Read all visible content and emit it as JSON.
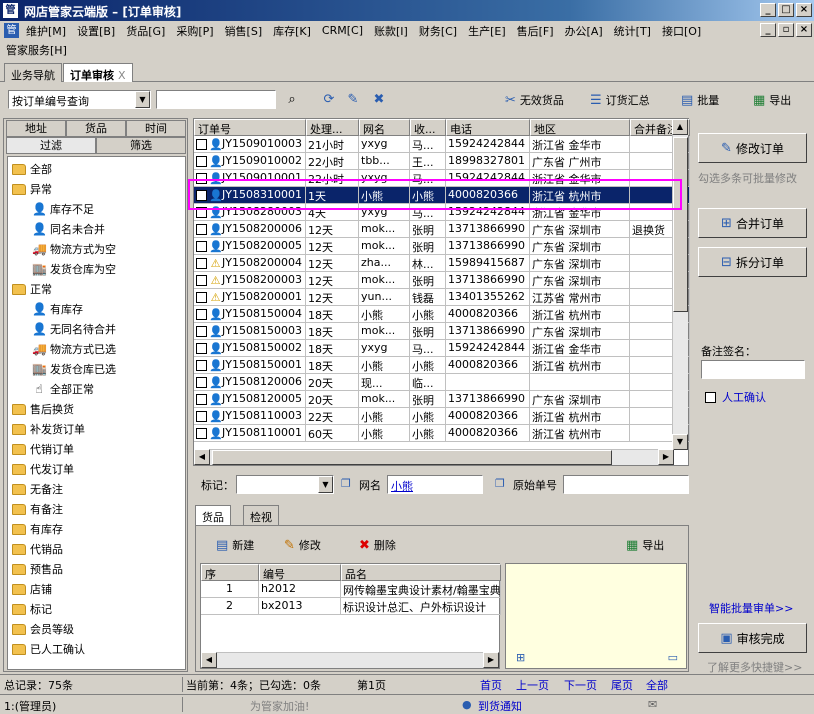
{
  "window": {
    "title": "网店管家云端版 – [订单审核]",
    "logo": "管"
  },
  "menu": [
    "维护[M]",
    "设置[B]",
    "货品[G]",
    "采购[P]",
    "销售[S]",
    "库存[K]",
    "CRM[C]",
    "账款[I]",
    "财务[C]",
    "生产[E]",
    "售后[F]",
    "办公[A]",
    "统计[T]",
    "接口[O]"
  ],
  "menu2": "管家服务[H]",
  "tabs": [
    {
      "label": "业务导航"
    },
    {
      "label": "订单审核"
    }
  ],
  "toolbar": {
    "query_mode": "按订单编号查询",
    "search_value": "",
    "invalid": "无效货品",
    "summary": "订货汇总",
    "batch": "批量",
    "export": "导出"
  },
  "left": {
    "tabs": [
      "地址",
      "货品",
      "时间",
      "过滤",
      "筛选"
    ],
    "tree": [
      {
        "label": "全部",
        "lvl": 0,
        "icon": "folder"
      },
      {
        "label": "异常",
        "lvl": 0,
        "icon": "folder"
      },
      {
        "label": "库存不足",
        "lvl": 1,
        "icon": "person"
      },
      {
        "label": "同名未合并",
        "lvl": 1,
        "icon": "person"
      },
      {
        "label": "物流方式为空",
        "lvl": 1,
        "icon": "truck"
      },
      {
        "label": "发货仓库为空",
        "lvl": 1,
        "icon": "warehouse"
      },
      {
        "label": "正常",
        "lvl": 0,
        "icon": "folder"
      },
      {
        "label": "有库存",
        "lvl": 1,
        "icon": "person"
      },
      {
        "label": "无同名待合并",
        "lvl": 1,
        "icon": "person"
      },
      {
        "label": "物流方式已选",
        "lvl": 1,
        "icon": "truck"
      },
      {
        "label": "发货仓库已选",
        "lvl": 1,
        "icon": "warehouse"
      },
      {
        "label": "全部正常",
        "lvl": 1,
        "icon": "hand"
      },
      {
        "label": "售后换货",
        "lvl": 0,
        "icon": "folder"
      },
      {
        "label": "补发货订单",
        "lvl": 0,
        "icon": "folder"
      },
      {
        "label": "代销订单",
        "lvl": 0,
        "icon": "folder"
      },
      {
        "label": "代发订单",
        "lvl": 0,
        "icon": "folder"
      },
      {
        "label": "无备注",
        "lvl": 0,
        "icon": "folder"
      },
      {
        "label": "有备注",
        "lvl": 0,
        "icon": "folder"
      },
      {
        "label": "有库存",
        "lvl": 0,
        "icon": "folder"
      },
      {
        "label": "代销品",
        "lvl": 0,
        "icon": "folder"
      },
      {
        "label": "预售品",
        "lvl": 0,
        "icon": "folder"
      },
      {
        "label": "店铺",
        "lvl": 0,
        "icon": "folder"
      },
      {
        "label": "标记",
        "lvl": 0,
        "icon": "folder"
      },
      {
        "label": "会员等级",
        "lvl": 0,
        "icon": "folder"
      },
      {
        "label": "已人工确认",
        "lvl": 0,
        "icon": "folder"
      }
    ]
  },
  "grid": {
    "headers": [
      "订单号",
      "处理...",
      "网名",
      "收...",
      "电话",
      "地区",
      "合并备注"
    ],
    "rows": [
      [
        "JY1509010003",
        "21小时",
        "yxyg",
        "马...",
        "15924242844",
        "浙江省 金华市",
        ""
      ],
      [
        "JY1509010002",
        "22小时",
        "tbb...",
        "王...",
        "18998327801",
        "广东省 广州市",
        ""
      ],
      [
        "JY1509010001",
        "22小时",
        "yxyg",
        "马...",
        "15924242844",
        "浙江省 金华市",
        ""
      ],
      [
        "JY1508310001",
        "1天",
        "小熊",
        "小熊",
        "4000820366",
        "浙江省 杭州市",
        ""
      ],
      [
        "JY1508280003",
        "4天",
        "yxyg",
        "马...",
        "15924242844",
        "浙江省 金华市",
        ""
      ],
      [
        "JY1508200006",
        "12天",
        "mok...",
        "张明",
        "13713866990",
        "广东省 深圳市",
        "退换货"
      ],
      [
        "JY1508200005",
        "12天",
        "mok...",
        "张明",
        "13713866990",
        "广东省 深圳市",
        ""
      ],
      [
        "JY1508200004",
        "12天",
        "zha...",
        "林...",
        "15989415687",
        "广东省 深圳市",
        ""
      ],
      [
        "JY1508200003",
        "12天",
        "mok...",
        "张明",
        "13713866990",
        "广东省 深圳市",
        ""
      ],
      [
        "JY1508200001",
        "12天",
        "yun...",
        "钱磊",
        "13401355262",
        "江苏省 常州市",
        ""
      ],
      [
        "JY1508150004",
        "18天",
        "小熊",
        "小熊",
        "4000820366",
        "浙江省 杭州市",
        ""
      ],
      [
        "JY1508150003",
        "18天",
        "mok...",
        "张明",
        "13713866990",
        "广东省 深圳市",
        ""
      ],
      [
        "JY1508150002",
        "18天",
        "yxyg",
        "马...",
        "15924242844",
        "浙江省 金华市",
        ""
      ],
      [
        "JY1508150001",
        "18天",
        "小熊",
        "小熊",
        "4000820366",
        "浙江省 杭州市",
        ""
      ],
      [
        "JY1508120006",
        "20天",
        "现...",
        "临...",
        "",
        "",
        ""
      ],
      [
        "JY1508120005",
        "20天",
        "mok...",
        "张明",
        "13713866990",
        "广东省 深圳市",
        ""
      ],
      [
        "JY1508110003",
        "22天",
        "小熊",
        "小熊",
        "4000820366",
        "浙江省 杭州市",
        ""
      ],
      [
        "JY1508110001",
        "60天",
        "小熊",
        "小熊",
        "4000820366",
        "浙江省 杭州市",
        ""
      ]
    ],
    "warn_rows": [
      7,
      8,
      9
    ]
  },
  "markbar": {
    "mark_label": "标记：",
    "netname_label": "网名",
    "netname_value": "小熊",
    "orig_label": "原始单号"
  },
  "detail": {
    "tabs": [
      "货品",
      "检视"
    ],
    "new": "新建",
    "edit": "修改",
    "delete": "删除",
    "export": "导出",
    "headers": [
      "序",
      "编号",
      "品名"
    ],
    "rows": [
      [
        "1",
        "h2012",
        "网传翰墨宝典设计素材/翰墨宝典"
      ],
      [
        "2",
        "bx2013",
        "标识设计总汇、户外标识设计"
      ]
    ]
  },
  "right": {
    "modify": "修改订单",
    "hint1": "勾选多条可批量修改",
    "merge": "合并订单",
    "split": "拆分订单",
    "remark_label": "备注签名：",
    "manual": "人工确认",
    "smart": "智能批量审单>>",
    "done": "审核完成",
    "more": "了解更多快捷键>>"
  },
  "status": {
    "total": "总记录：75条",
    "current": "当前第：4条；已勾选：0条",
    "page": "第1页",
    "first": "首页",
    "prev": "上一页",
    "next": "下一页",
    "last": "尾页",
    "all": "全部",
    "user": "1:(管理员)",
    "promo": "为管家加油!",
    "notice": "到货通知"
  }
}
